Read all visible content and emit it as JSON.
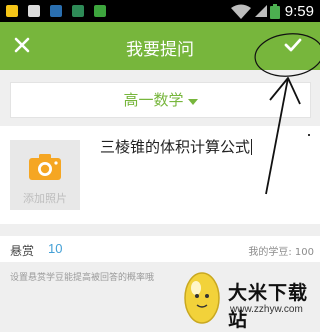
{
  "status_bar": {
    "time": "9:59"
  },
  "header": {
    "title": "我要提问"
  },
  "subject": {
    "selected": "高一数学"
  },
  "question": {
    "text": "三棱锥的体积计算公式",
    "add_photo_label": "添加照片"
  },
  "reward": {
    "label": "悬赏",
    "value": "10",
    "my_beans": "我的学豆: 100"
  },
  "hint": {
    "text": "设置悬赏学豆能提高被回答的概率哦"
  },
  "watermark": {
    "title": "大米下载站",
    "url": "www.zzhyw.com"
  },
  "colors": {
    "accent": "#77b63c",
    "reward_value": "#44a0d6",
    "camera": "#f5a623"
  }
}
